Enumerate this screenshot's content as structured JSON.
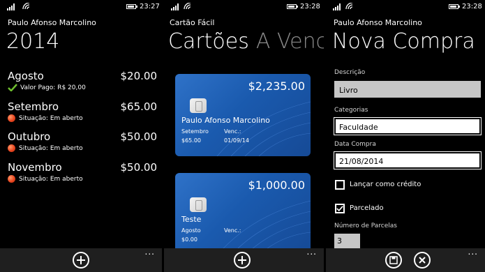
{
  "screens": [
    {
      "status": {
        "time": "23:27"
      },
      "app_name": "Paulo Afonso Marcolino",
      "page_title": "2014",
      "months": [
        {
          "name": "Agosto",
          "amount": "$20.00",
          "status": "Valor Pago: R$ 20,00",
          "status_icon": "check-icon",
          "status_color": "#6fbf2e"
        },
        {
          "name": "Setembro",
          "amount": "$65.00",
          "status": "Situação: Em aberto",
          "status_icon": "open-status-icon",
          "status_color": "#e8451f"
        },
        {
          "name": "Outubro",
          "amount": "$50.00",
          "status": "Situação: Em aberto",
          "status_icon": "open-status-icon",
          "status_color": "#e8451f"
        },
        {
          "name": "Novembro",
          "amount": "$50.00",
          "status": "Situação: Em aberto",
          "status_icon": "open-status-icon",
          "status_color": "#e8451f"
        }
      ],
      "appbar": {
        "buttons": [
          "add-icon"
        ],
        "more": "..."
      }
    },
    {
      "status": {
        "time": "23:28"
      },
      "app_name": "Cartão Fácil",
      "page_title": "Cartões",
      "next_pivot": "A Venc",
      "cards": [
        {
          "balance": "$2,235.00",
          "holder": "Paulo Afonso Marcolino",
          "month_label": "Setembro",
          "month_value": "$65.00",
          "due_label": "Venc.:",
          "due_value": "01/09/14"
        },
        {
          "balance": "$1,000.00",
          "holder": "Teste",
          "month_label": "Agosto",
          "month_value": "$0.00",
          "due_label": "Venc.:",
          "due_value": ""
        }
      ],
      "appbar": {
        "buttons": [
          "add-icon"
        ],
        "more": "..."
      }
    },
    {
      "status": {
        "time": "23:28"
      },
      "app_name": "Paulo Afonso Marcolino",
      "page_title": "Nova Compra",
      "form": {
        "descricao_label": "Descrição",
        "descricao_value": "Livro",
        "categorias_label": "Categorias",
        "categorias_value": "Faculdade",
        "data_label": "Data Compra",
        "data_value": "21/08/2014",
        "credito_label": "Lançar como crédito",
        "credito_checked": false,
        "parcelado_label": "Parcelado",
        "parcelado_checked": true,
        "parcelas_label": "Número de Parcelas",
        "parcelas_value": "3"
      },
      "appbar": {
        "buttons": [
          "save-icon",
          "cancel-icon"
        ],
        "more": "..."
      }
    }
  ],
  "colors": {
    "background": "#000000",
    "appbar": "#1f1f1f",
    "card_blue": "#1a5aae",
    "paid": "#6fbf2e",
    "open": "#e8451f",
    "pivot_inactive": "#8a8a8a"
  }
}
